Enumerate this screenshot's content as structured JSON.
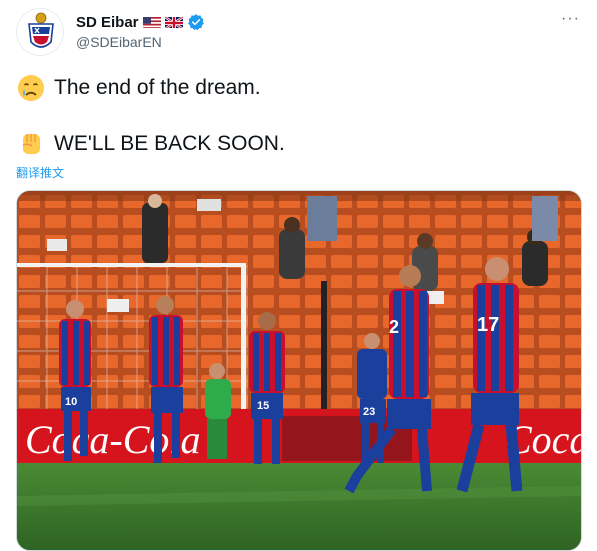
{
  "account": {
    "display_name": "SD Eibar",
    "handle": "@SDEibarEN",
    "flags": [
      "us-flag-icon",
      "uk-flag-icon"
    ],
    "verified": true
  },
  "tweet": {
    "line1_emoji": "crying-face-emoji",
    "line1_text": "The end of the dream.",
    "line2_emoji": "raised-fist-emoji",
    "line2_text": "WE'LL BE BACK SOON.",
    "translate_label": "翻译推文"
  },
  "photo": {
    "board_text_left": "Coca-Cola",
    "board_text_right": "Coca",
    "jersey_numbers": [
      "10",
      "15",
      "23",
      "2",
      "17"
    ]
  },
  "colors": {
    "link_blue": "#1d9bf0",
    "eibar_red": "#c8102e",
    "eibar_blue": "#1b3f9c",
    "seat_orange": "#e8682c",
    "pitch_green": "#3f7a2e"
  },
  "more_label": "···"
}
